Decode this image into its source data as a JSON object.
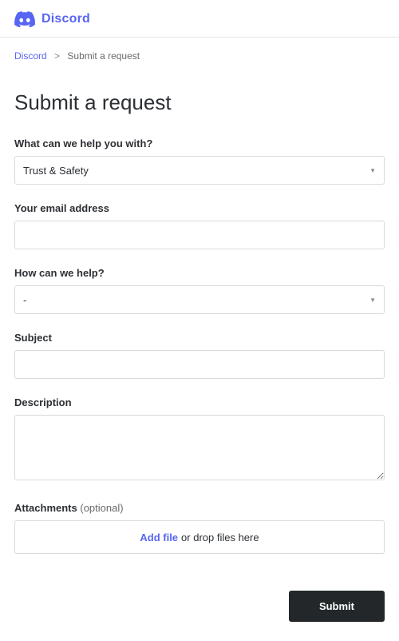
{
  "brand": "Discord",
  "breadcrumb": {
    "root": "Discord",
    "current": "Submit a request"
  },
  "page_title": "Submit a request",
  "form": {
    "help_with": {
      "label": "What can we help you with?",
      "value": "Trust & Safety"
    },
    "email": {
      "label": "Your email address",
      "value": ""
    },
    "how_help": {
      "label": "How can we help?",
      "value": "-"
    },
    "subject": {
      "label": "Subject",
      "value": ""
    },
    "description": {
      "label": "Description",
      "value": ""
    },
    "attachments": {
      "label": "Attachments",
      "optional": "(optional)",
      "add_file": "Add file",
      "drop_text": "or drop files here"
    },
    "submit": "Submit"
  }
}
